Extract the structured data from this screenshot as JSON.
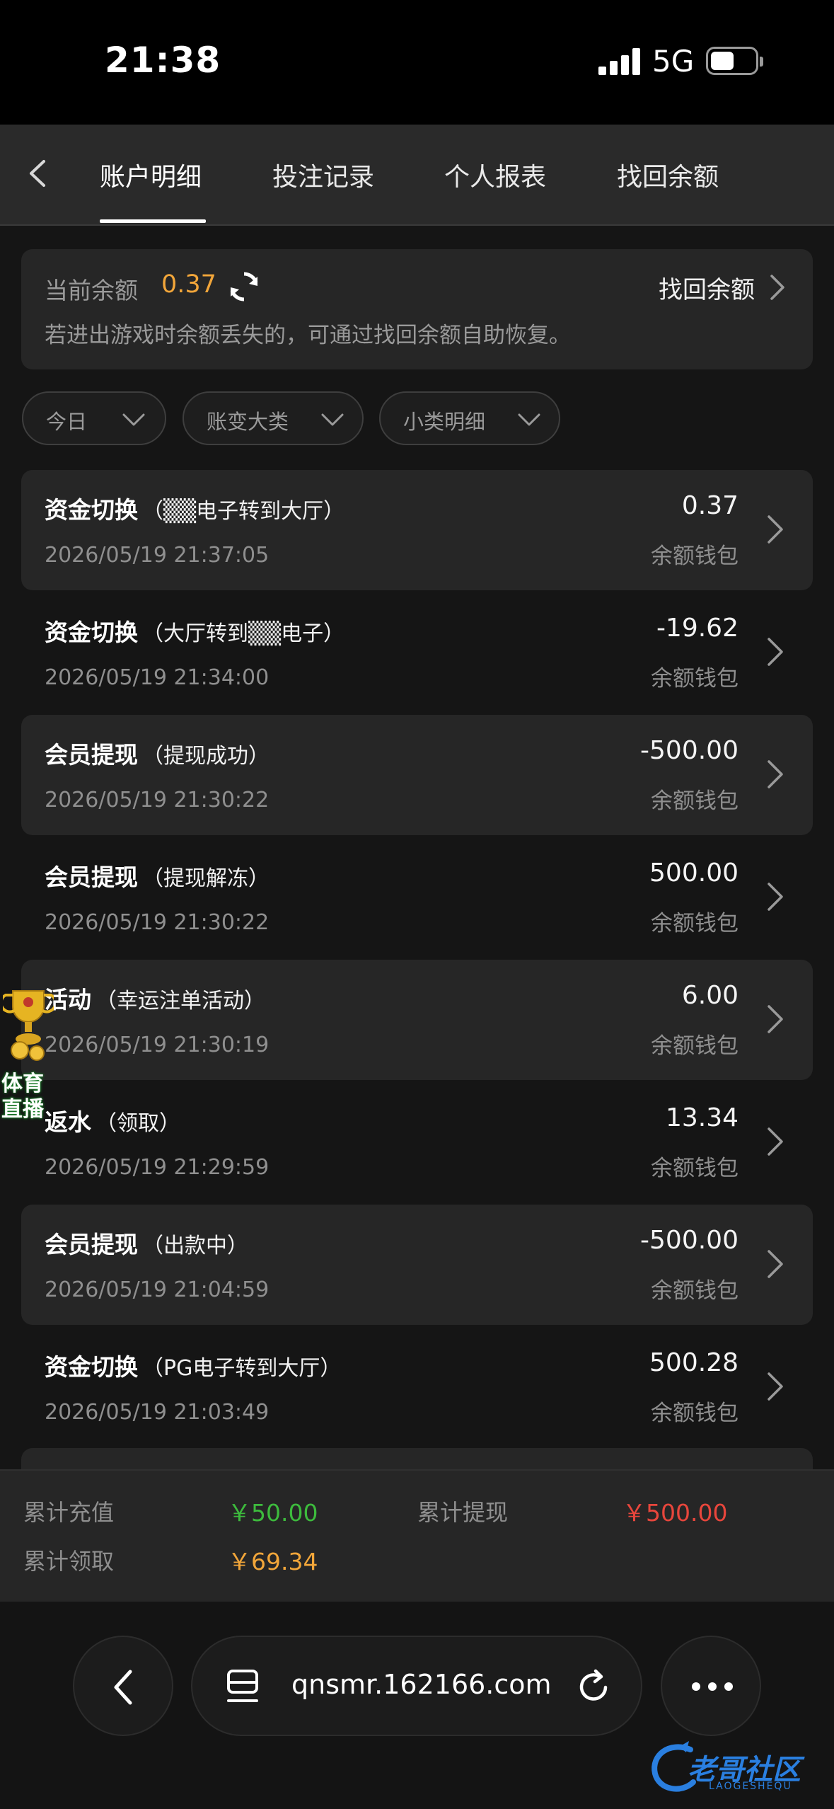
{
  "status_bar": {
    "time": "21:38",
    "network": "5G"
  },
  "nav": {
    "tabs": [
      {
        "label": "账户明细",
        "active": true
      },
      {
        "label": "投注记录",
        "active": false
      },
      {
        "label": "个人报表",
        "active": false
      },
      {
        "label": "找回余额",
        "active": false
      }
    ]
  },
  "balance": {
    "label": "当前余额",
    "value": "0.37",
    "recover_label": "找回余额",
    "tip": "若进出游戏时余额丢失的，可通过找回余额自助恢复。"
  },
  "filters": [
    {
      "label": "今日"
    },
    {
      "label": "账变大类"
    },
    {
      "label": "小类明细"
    }
  ],
  "transactions": [
    {
      "type": "资金切换",
      "detail": "（▒▒电子转到大厅）",
      "time": "2026/05/19 21:37:05",
      "amount": "0.37",
      "wallet": "余额钱包"
    },
    {
      "type": "资金切换",
      "detail": "（大厅转到▒▒电子）",
      "time": "2026/05/19 21:34:00",
      "amount": "-19.62",
      "wallet": "余额钱包"
    },
    {
      "type": "会员提现",
      "detail": "（提现成功）",
      "time": "2026/05/19 21:30:22",
      "amount": "-500.00",
      "wallet": "余额钱包"
    },
    {
      "type": "会员提现",
      "detail": "（提现解冻）",
      "time": "2026/05/19 21:30:22",
      "amount": "500.00",
      "wallet": "余额钱包"
    },
    {
      "type": "活动",
      "detail": "（幸运注单活动）",
      "time": "2026/05/19 21:30:19",
      "amount": "6.00",
      "wallet": "余额钱包"
    },
    {
      "type": "返水",
      "detail": "（领取）",
      "time": "2026/05/19 21:29:59",
      "amount": "13.34",
      "wallet": "余额钱包"
    },
    {
      "type": "会员提现",
      "detail": "（出款中）",
      "time": "2026/05/19 21:04:59",
      "amount": "-500.00",
      "wallet": "余额钱包"
    },
    {
      "type": "资金切换",
      "detail": "（PG电子转到大厅）",
      "time": "2026/05/19 21:03:49",
      "amount": "500.28",
      "wallet": "余额钱包"
    }
  ],
  "summary": {
    "recharge_label": "累计充值",
    "recharge_value": "￥50.00",
    "withdraw_label": "累计提现",
    "withdraw_value": "￥500.00",
    "claim_label": "累计领取",
    "claim_value": "￥69.34"
  },
  "browser": {
    "url": "qnsmr.162166.com"
  },
  "promo": {
    "line1": "体育",
    "line2": "直播"
  },
  "watermark": {
    "text": "老哥社区",
    "sub": "LAOGESHEQU"
  },
  "colors": {
    "accent_orange": "#f2a63a",
    "recharge_green": "#3dbb3d",
    "withdraw_red": "#e8463c",
    "claim_orange": "#f2a63a"
  }
}
